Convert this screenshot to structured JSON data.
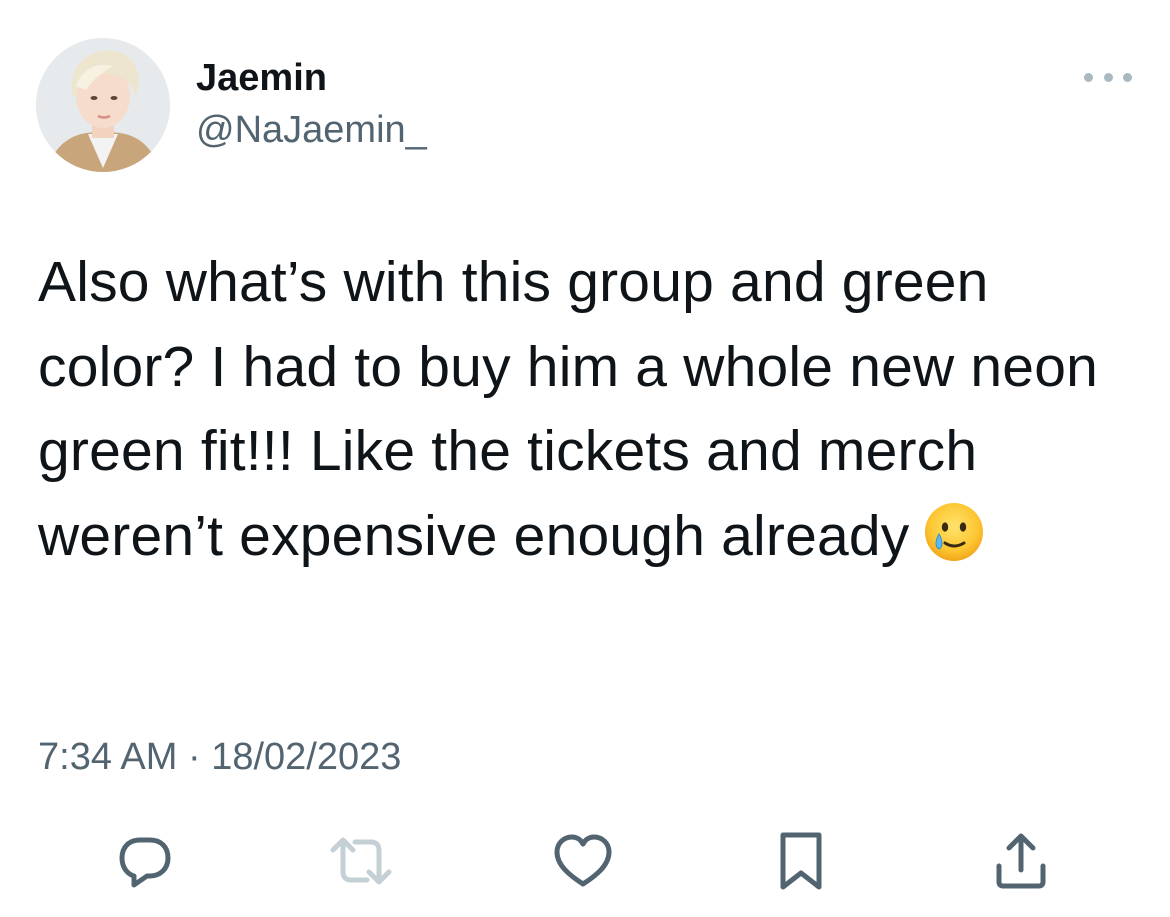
{
  "author": {
    "display_name": "Jaemin",
    "handle": "@NaJaemin_"
  },
  "tweet": {
    "text": "Also what’s with this group and green color? I had to buy him a whole new neon green fit!!! Like the tickets and merch weren’t expensive enough already",
    "emoji": "smiling-face-with-tear",
    "timestamp": "7:34 AM · 18/02/2023"
  },
  "actions": {
    "reply_icon": "reply-icon",
    "retweet_icon": "retweet-icon",
    "like_icon": "heart-icon",
    "bookmark_icon": "bookmark-icon",
    "share_icon": "share-icon"
  },
  "colors": {
    "text_primary": "#0f1419",
    "text_secondary": "#536471",
    "icon": "#536471",
    "retweet_disabled": "#c4cfd6"
  }
}
